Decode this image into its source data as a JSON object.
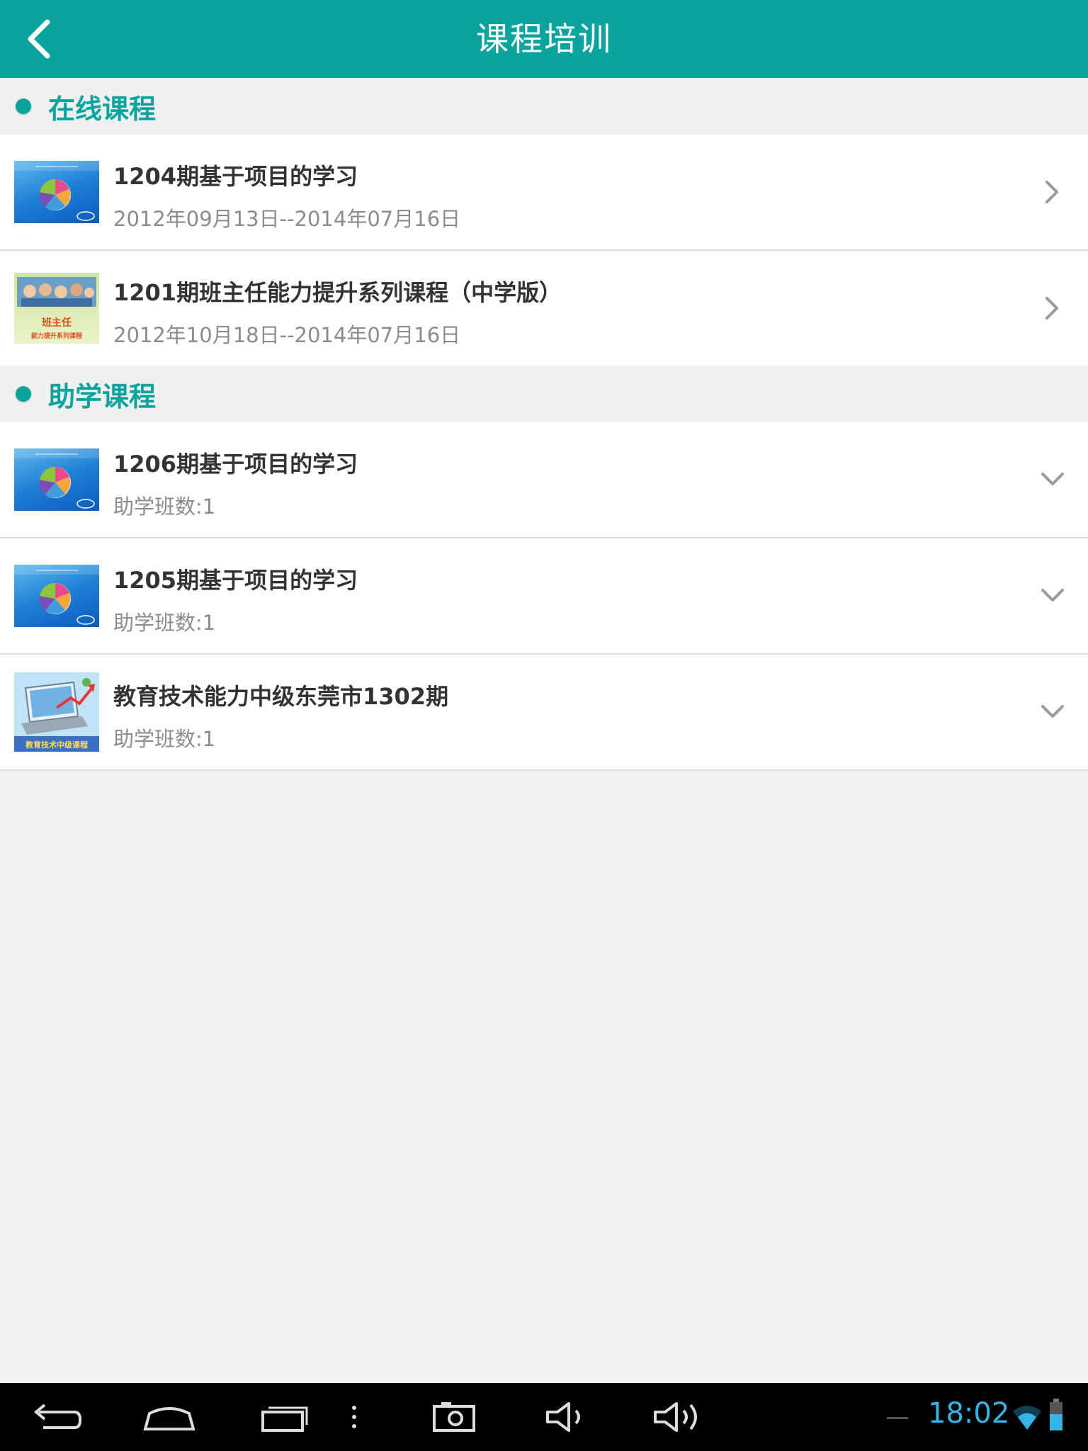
{
  "header": {
    "title": "课程培训",
    "back_icon": "chevron-left-icon"
  },
  "sections": [
    {
      "label": "在线课程",
      "items": [
        {
          "title": "1204期基于项目的学习",
          "subtitle": "2012年09月13日--2014年07月16日",
          "thumb": "intel-course-thumbnail",
          "action_icon": "chevron-right-icon"
        },
        {
          "title": "1201期班主任能力提升系列课程（中学版）",
          "subtitle": "2012年10月18日--2014年07月16日",
          "thumb": "class-teacher-course-thumbnail",
          "thumb_text": "班主任",
          "thumb_text2": "能力提升系列课程",
          "action_icon": "chevron-right-icon"
        }
      ]
    },
    {
      "label": "助学课程",
      "items": [
        {
          "title": "1206期基于项目的学习",
          "subtitle": "助学班数:1",
          "thumb": "intel-course-thumbnail",
          "action_icon": "chevron-down-icon"
        },
        {
          "title": "1205期基于项目的学习",
          "subtitle": "助学班数:1",
          "thumb": "intel-course-thumbnail",
          "action_icon": "chevron-down-icon"
        },
        {
          "title": "教育技术能力中级东莞市1302期",
          "subtitle": "助学班数:1",
          "thumb": "edu-tech-course-thumbnail",
          "thumb_text": "教育技术中级课程",
          "action_icon": "chevron-down-icon"
        }
      ]
    }
  ],
  "system_bar": {
    "time": "18:02",
    "icons": [
      "back-icon",
      "home-icon",
      "recent-apps-icon",
      "menu-icon",
      "screenshot-icon",
      "volume-down-icon",
      "volume-up-icon",
      "wifi-icon",
      "battery-icon"
    ],
    "accent_color": "#33b5e5"
  },
  "colors": {
    "primary": "#0aa49e",
    "background": "#f2f2f2",
    "title_text": "#333333",
    "sub_text": "#8c8c8c"
  }
}
